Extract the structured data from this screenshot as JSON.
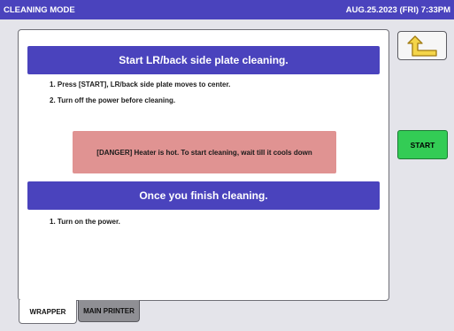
{
  "topbar": {
    "title": "CLEANING MODE",
    "datetime": "AUG.25.2023 (FRI)  7:33PM"
  },
  "colors": {
    "header_bg": "#4a43bd",
    "danger_bg": "#e09392",
    "start_green": "#33cc55",
    "screen_bg": "#e4e4ea"
  },
  "section1": {
    "header": "Start LR/back side plate cleaning.",
    "steps": [
      "1. Press [START], LR/back side plate moves to center.",
      "2. Turn off the power before cleaning."
    ]
  },
  "danger": {
    "message": "[DANGER] Heater is hot. To start cleaning, wait till it cools down"
  },
  "section2": {
    "header": "Once you finish cleaning.",
    "steps": [
      "1. Turn on the power."
    ]
  },
  "buttons": {
    "back_icon": "return-arrow-icon",
    "start_label": "START"
  },
  "tabs": [
    {
      "label": "WRAPPER",
      "active": true
    },
    {
      "label": "MAIN PRINTER",
      "active": false
    }
  ]
}
